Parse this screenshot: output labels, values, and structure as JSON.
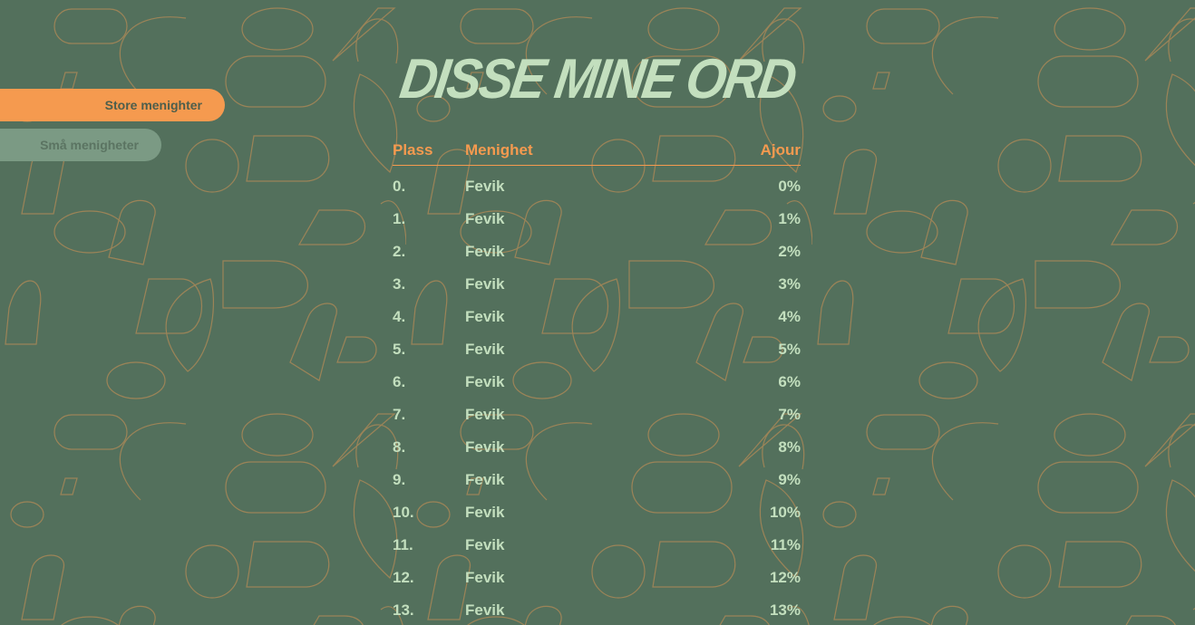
{
  "title": "DISSE MINE ORD",
  "tabs": [
    {
      "label": "Store menighter",
      "active": true
    },
    {
      "label": "Små menigheter",
      "active": false
    }
  ],
  "table": {
    "headers": {
      "place": "Plass",
      "church": "Menighet",
      "score": "Ajour"
    },
    "rows": [
      {
        "place": "0.",
        "church": "Fevik",
        "score": "0%"
      },
      {
        "place": "1.",
        "church": "Fevik",
        "score": "1%"
      },
      {
        "place": "2.",
        "church": "Fevik",
        "score": "2%"
      },
      {
        "place": "3.",
        "church": "Fevik",
        "score": "3%"
      },
      {
        "place": "4.",
        "church": "Fevik",
        "score": "4%"
      },
      {
        "place": "5.",
        "church": "Fevik",
        "score": "5%"
      },
      {
        "place": "6.",
        "church": "Fevik",
        "score": "6%"
      },
      {
        "place": "7.",
        "church": "Fevik",
        "score": "7%"
      },
      {
        "place": "8.",
        "church": "Fevik",
        "score": "8%"
      },
      {
        "place": "9.",
        "church": "Fevik",
        "score": "9%"
      },
      {
        "place": "10.",
        "church": "Fevik",
        "score": "10%"
      },
      {
        "place": "11.",
        "church": "Fevik",
        "score": "11%"
      },
      {
        "place": "12.",
        "church": "Fevik",
        "score": "12%"
      },
      {
        "place": "13.",
        "church": "Fevik",
        "score": "13%"
      }
    ]
  },
  "colors": {
    "background": "#53705c",
    "accent": "#f59a4f",
    "text": "#c3dfbe",
    "pattern_stroke": "#b48a55",
    "inactive_tab": "#7b9a84"
  }
}
